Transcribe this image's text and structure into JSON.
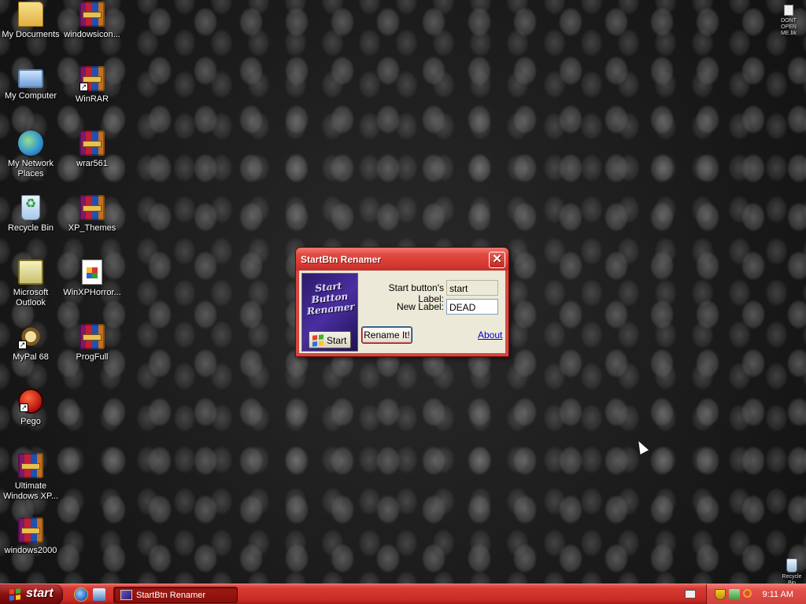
{
  "desktop": {
    "icons_col1": [
      {
        "label": "My Documents",
        "icon": "folder-icon"
      },
      {
        "label": "My Computer",
        "icon": "computer-icon"
      },
      {
        "label": "My Network Places",
        "icon": "network-icon"
      },
      {
        "label": "Recycle Bin",
        "icon": "recycle-bin-icon"
      },
      {
        "label": "Microsoft Outlook",
        "icon": "outlook-icon"
      },
      {
        "label": "MyPal 68",
        "icon": "mypal-icon"
      },
      {
        "label": "Pego",
        "icon": "pego-icon"
      },
      {
        "label": "Ultimate Windows XP...",
        "icon": "winrar-icon"
      },
      {
        "label": "windows2000",
        "icon": "winrar-icon"
      }
    ],
    "icons_col2": [
      {
        "label": "windowsicon...",
        "icon": "winrar-icon"
      },
      {
        "label": "WinRAR",
        "icon": "winrar-icon"
      },
      {
        "label": "wrar561",
        "icon": "winrar-icon"
      },
      {
        "label": "XP_Themes",
        "icon": "winrar-icon"
      },
      {
        "label": "WinXPHorror...",
        "icon": "document-icon"
      },
      {
        "label": "ProgFull",
        "icon": "winrar-icon"
      }
    ],
    "top_right_icon": {
      "label": "DONT OPEN ME.bk"
    },
    "bottom_right_icon": {
      "label": "Recycle Bin"
    }
  },
  "dialog": {
    "title": "StartBtn Renamer",
    "banner_text": "Start Button Renamer",
    "banner_button_label": "Start",
    "start_label_caption": "Start button's Label:",
    "start_label_value": "start",
    "new_label_caption": "New Label:",
    "new_label_value": "DEAD",
    "rename_button": "Rename It!",
    "about_link": "About",
    "close_glyph": "✕"
  },
  "taskbar": {
    "start_label": "start",
    "task_item": "StartBtn Renamer",
    "clock": "9:11 AM"
  },
  "colors": {
    "taskbar_red": "#c82a24",
    "dialog_frame": "#d8463f",
    "dialog_client": "#ece9d8",
    "link_blue": "#0000cc"
  }
}
